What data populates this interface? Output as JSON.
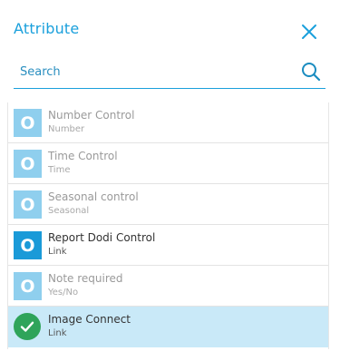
{
  "header": {
    "title": "Attribute",
    "close_icon": "close-icon"
  },
  "search": {
    "placeholder": "Search",
    "value": "",
    "icon": "search-icon"
  },
  "colors": {
    "accent": "#1aa0dc",
    "badge_disabled": "#8fcfee",
    "badge_active": "#1a9ad8",
    "selected_row": "#c9e9f8",
    "check": "#2fa45a"
  },
  "items": [
    {
      "badge": "O",
      "name": "Number Control",
      "type": "Number",
      "state": "disabled"
    },
    {
      "badge": "O",
      "name": "Time Control",
      "type": "Time",
      "state": "disabled"
    },
    {
      "badge": "O",
      "name": "Seasonal control",
      "type": "Seasonal",
      "state": "disabled"
    },
    {
      "badge": "O",
      "name": "Report Dodi Control",
      "type": "Link",
      "state": "enabled"
    },
    {
      "badge": "O",
      "name": "Note required",
      "type": "Yes/No",
      "state": "disabled"
    },
    {
      "badge": "check-icon",
      "name": "Image Connect",
      "type": "Link",
      "state": "selected"
    }
  ]
}
